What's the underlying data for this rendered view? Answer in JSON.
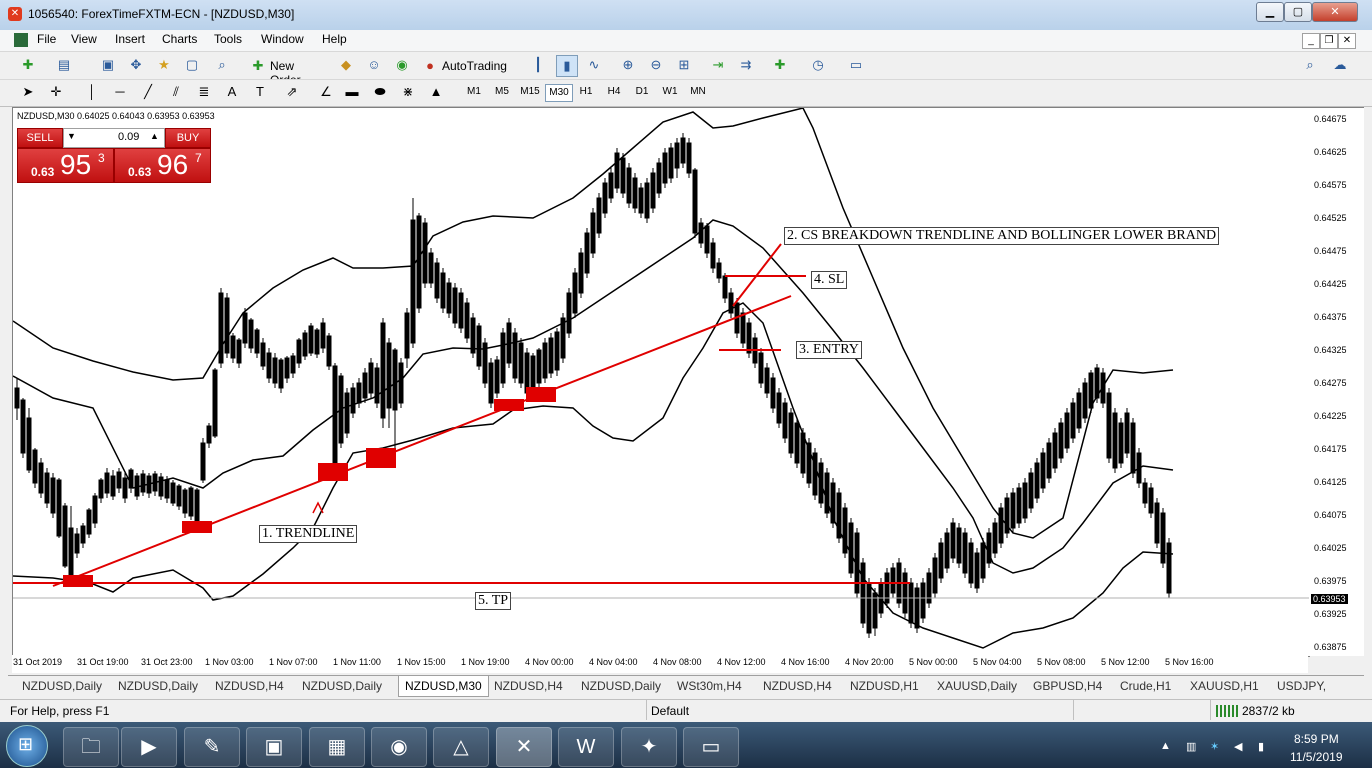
{
  "window": {
    "title": "1056540: ForexTimeFXTM-ECN - [NZDUSD,M30]",
    "min_btn": "▁",
    "max_btn": "▢",
    "close_btn": "✕"
  },
  "menu": [
    "File",
    "View",
    "Insert",
    "Charts",
    "Tools",
    "Window",
    "Help"
  ],
  "toolbar": {
    "new_order": "New Order",
    "autotrading": "AutoTrading"
  },
  "timeframes": [
    "M1",
    "M5",
    "M15",
    "M30",
    "H1",
    "H4",
    "D1",
    "W1",
    "MN"
  ],
  "active_timeframe": "M30",
  "chart": {
    "info": "NZDUSD,M30  0.64025 0.64043 0.63953 0.63953",
    "current_price": "0.63953",
    "price_labels": [
      "0.64675",
      "0.64625",
      "0.64575",
      "0.64525",
      "0.64475",
      "0.64425",
      "0.64375",
      "0.64325",
      "0.64275",
      "0.64225",
      "0.64175",
      "0.64125",
      "0.64075",
      "0.64025",
      "0.63975",
      "0.63925",
      "0.63875"
    ],
    "time_labels": [
      "31 Oct 2019",
      "31 Oct 19:00",
      "31 Oct 23:00",
      "1 Nov 03:00",
      "1 Nov 07:00",
      "1 Nov 11:00",
      "1 Nov 15:00",
      "1 Nov 19:00",
      "4 Nov 00:00",
      "4 Nov 04:00",
      "4 Nov 08:00",
      "4 Nov 12:00",
      "4 Nov 16:00",
      "4 Nov 20:00",
      "5 Nov 00:00",
      "5 Nov 04:00",
      "5 Nov 08:00",
      "5 Nov 12:00",
      "5 Nov 16:00"
    ],
    "annotations": {
      "trendline": "1. TRENDLINE",
      "breakdown": "2. CS BREAKDOWN TRENDLINE AND BOLLINGER LOWER BRAND",
      "entry": "3. ENTRY",
      "sl": "4. SL",
      "tp": "5. TP"
    },
    "colors": {
      "trendline": "#e00000",
      "bands": "#000000",
      "candles": "#000000"
    }
  },
  "trade_panel": {
    "sell_label": "SELL",
    "buy_label": "BUY",
    "lot": "0.09",
    "sell_small": "0.63",
    "sell_big": "95",
    "sell_sup": "3",
    "buy_small": "0.63",
    "buy_big": "96",
    "buy_sup": "7"
  },
  "tabs": [
    "NZDUSD,Daily",
    "NZDUSD,Daily",
    "NZDUSD,H4",
    "NZDUSD,Daily",
    "NZDUSD,M30",
    "NZDUSD,H4",
    "NZDUSD,Daily",
    "WSt30m,H4",
    "NZDUSD,H4",
    "NZDUSD,H1",
    "XAUUSD,Daily",
    "GBPUSD,H4",
    "Crude,H1",
    "XAUUSD,H1",
    "USDJPY,"
  ],
  "active_tab_index": 4,
  "status": {
    "help": "For Help, press F1",
    "profile": "Default",
    "traffic": "2837/2 kb"
  },
  "clock": {
    "time": "8:59 PM",
    "date": "11/5/2019"
  }
}
